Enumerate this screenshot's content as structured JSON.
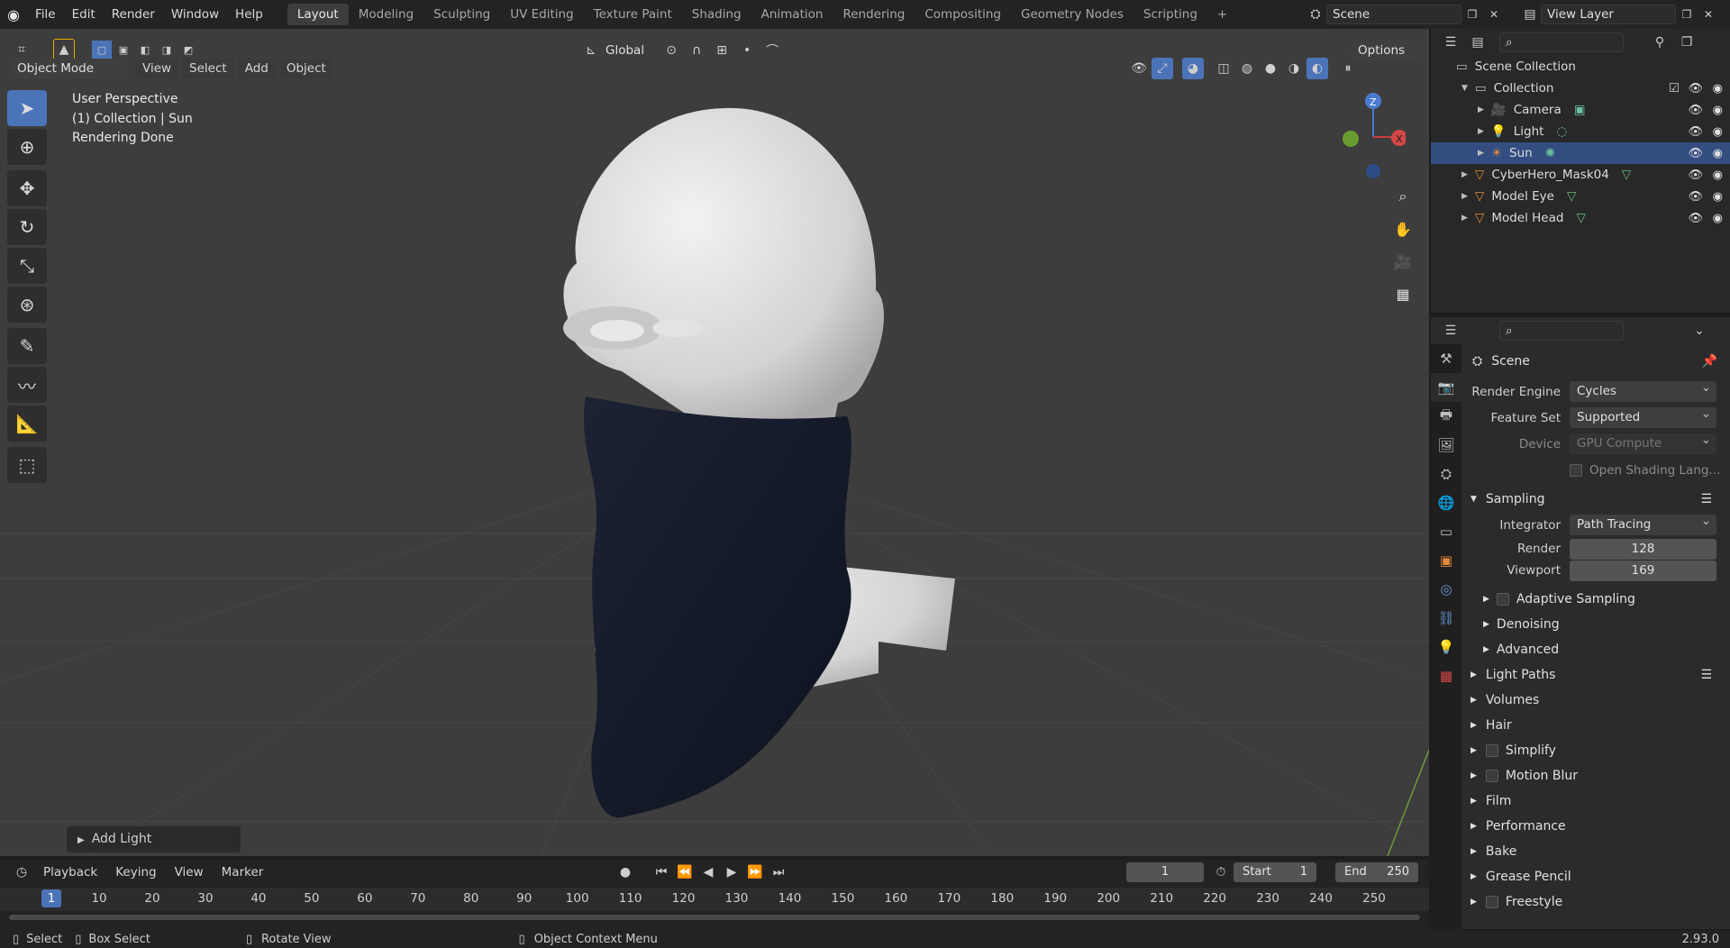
{
  "topbar": {
    "menus": [
      "File",
      "Edit",
      "Render",
      "Window",
      "Help"
    ],
    "workspaces": [
      "Layout",
      "Modeling",
      "Sculpting",
      "UV Editing",
      "Texture Paint",
      "Shading",
      "Animation",
      "Rendering",
      "Compositing",
      "Geometry Nodes",
      "Scripting"
    ],
    "active_workspace": "Layout",
    "scene": "Scene",
    "view_layer": "View Layer"
  },
  "viewport": {
    "transform_orientation": "Global",
    "options_label": "Options",
    "mode": "Object Mode",
    "header_menus": [
      "View",
      "Select",
      "Add",
      "Object"
    ],
    "overlay_lines": [
      "User Perspective",
      "(1) Collection | Sun",
      "Rendering Done"
    ],
    "last_operator": "Add Light",
    "gizmo_axes": {
      "z": "Z",
      "x": "X"
    }
  },
  "outliner": {
    "root": "Scene Collection",
    "collection": "Collection",
    "items": [
      {
        "label": "Camera",
        "indent": 2,
        "icon": "camera-icon",
        "selected": false
      },
      {
        "label": "Light",
        "indent": 2,
        "icon": "light-icon",
        "selected": false
      },
      {
        "label": "Sun",
        "indent": 2,
        "icon": "sun-icon",
        "selected": true
      },
      {
        "label": "CyberHero_Mask04",
        "indent": 1,
        "icon": "mesh-icon",
        "selected": false
      },
      {
        "label": "Model Eye",
        "indent": 1,
        "icon": "mesh-icon",
        "selected": false
      },
      {
        "label": "Model Head",
        "indent": 1,
        "icon": "mesh-icon",
        "selected": false
      }
    ]
  },
  "properties": {
    "context": "Scene",
    "render_engine_label": "Render Engine",
    "render_engine": "Cycles",
    "feature_set_label": "Feature Set",
    "feature_set": "Supported",
    "device_label": "Device",
    "device": "GPU Compute",
    "osl_label": "Open Shading Lang...",
    "sampling": "Sampling",
    "integrator_label": "Integrator",
    "integrator": "Path Tracing",
    "render_label": "Render",
    "render_samples": "128",
    "viewport_label": "Viewport",
    "viewport_samples": "169",
    "subsections": [
      "Adaptive Sampling",
      "Denoising",
      "Advanced"
    ],
    "panels": [
      "Light Paths",
      "Volumes",
      "Hair",
      "Simplify",
      "Motion Blur",
      "Film",
      "Performance",
      "Bake",
      "Grease Pencil",
      "Freestyle"
    ]
  },
  "timeline": {
    "menus": [
      "Playback",
      "Keying",
      "View",
      "Marker"
    ],
    "current_frame": "1",
    "start_label": "Start",
    "start": "1",
    "end_label": "End",
    "end": "250",
    "ticks": [
      "1",
      "10",
      "20",
      "30",
      "40",
      "50",
      "60",
      "70",
      "80",
      "90",
      "100",
      "110",
      "120",
      "130",
      "140",
      "150",
      "160",
      "170",
      "180",
      "190",
      "200",
      "210",
      "220",
      "230",
      "240",
      "250"
    ]
  },
  "statusbar": {
    "select": "Select",
    "box_select": "Box Select",
    "rotate_view": "Rotate View",
    "context_menu": "Object Context Menu",
    "version": "2.93.0"
  }
}
